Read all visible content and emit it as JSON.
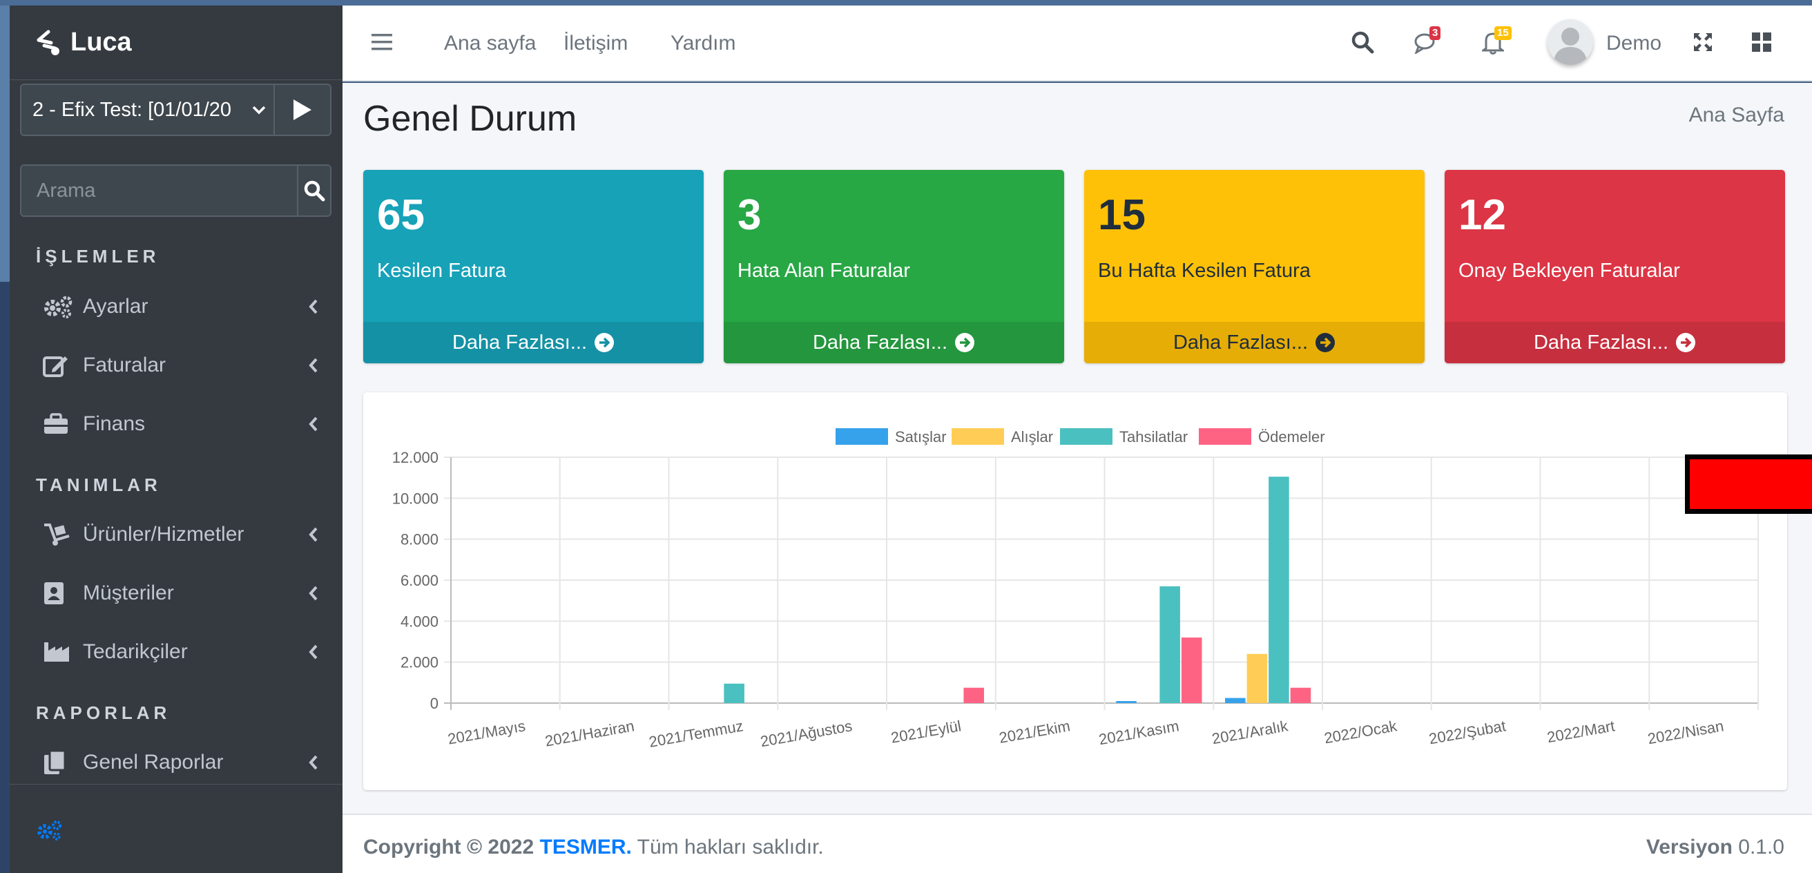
{
  "sidebar": {
    "brand": "Luca",
    "company_select": "2 - Efix Test: [01/01/20",
    "search_placeholder": "Arama",
    "sections": {
      "islemler": "İŞLEMLER",
      "tanimlar": "TANIMLAR",
      "raporlar": "RAPORLAR"
    },
    "items": [
      {
        "label": "Ayarlar",
        "icon": "cogs-icon"
      },
      {
        "label": "Faturalar",
        "icon": "edit-icon"
      },
      {
        "label": "Finans",
        "icon": "briefcase-icon"
      },
      {
        "label": "Ürünler/Hizmetler",
        "icon": "dolly-icon"
      },
      {
        "label": "Müşteriler",
        "icon": "address-book-icon"
      },
      {
        "label": "Tedarikçiler",
        "icon": "industry-icon"
      },
      {
        "label": "Genel Raporlar",
        "icon": "copy-icon"
      }
    ]
  },
  "topnav": {
    "links": [
      "Ana sayfa",
      "İletişim",
      "Yardım"
    ],
    "messages_badge": "3",
    "notifications_badge": "15",
    "user_name": "Demo"
  },
  "content": {
    "title": "Genel Durum",
    "breadcrumb": "Ana Sayfa",
    "boxes": [
      {
        "value": "65",
        "label": "Kesilen Fatura",
        "more": "Daha Fazlası...",
        "color": "#17a2b8"
      },
      {
        "value": "3",
        "label": "Hata Alan Faturalar",
        "more": "Daha Fazlası...",
        "color": "#28a745"
      },
      {
        "value": "15",
        "label": "Bu Hafta Kesilen Fatura",
        "more": "Daha Fazlası...",
        "color": "#ffc107"
      },
      {
        "value": "12",
        "label": "Onay Bekleyen Faturalar",
        "more": "Daha Fazlası...",
        "color": "#dc3545"
      }
    ]
  },
  "chart_data": {
    "type": "bar",
    "categories": [
      "2021/Mayıs",
      "2021/Haziran",
      "2021/Temmuz",
      "2021/Ağustos",
      "2021/Eylül",
      "2021/Ekim",
      "2021/Kasım",
      "2021/Aralık",
      "2022/Ocak",
      "2022/Şubat",
      "2022/Mart",
      "2022/Nisan"
    ],
    "series": [
      {
        "name": "Satışlar",
        "color": "#36a2eb",
        "values": [
          0,
          0,
          0,
          0,
          0,
          0,
          100,
          250,
          0,
          0,
          0,
          0
        ]
      },
      {
        "name": "Alışlar",
        "color": "#ffcd56",
        "values": [
          0,
          0,
          0,
          0,
          0,
          0,
          0,
          2400,
          0,
          0,
          0,
          0
        ]
      },
      {
        "name": "Tahsilatlar",
        "color": "#4bc0c0",
        "values": [
          0,
          0,
          950,
          0,
          0,
          0,
          5700,
          11050,
          0,
          0,
          0,
          0
        ]
      },
      {
        "name": "Ödemeler",
        "color": "#ff6384",
        "values": [
          0,
          0,
          0,
          0,
          750,
          0,
          3200,
          750,
          0,
          0,
          0,
          0
        ]
      }
    ],
    "yticks": [
      "12.000",
      "10.000",
      "8.000",
      "6.000",
      "4.000",
      "2.000",
      "0"
    ],
    "ylim": [
      0,
      12000
    ],
    "legend": "top",
    "grid": true
  },
  "footer": {
    "copyright": "Copyright © 2022",
    "brand": "TESMER.",
    "rights": "Tüm hakları saklıdır.",
    "version_label": "Versiyon",
    "version": "0.1.0"
  }
}
